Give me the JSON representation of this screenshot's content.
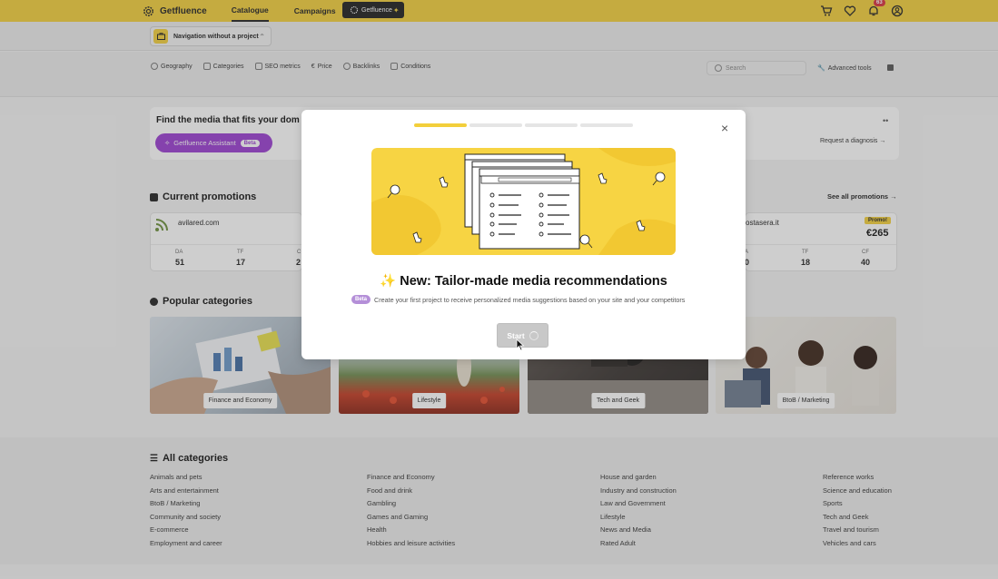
{
  "nav": {
    "brand": "Getfluence",
    "links": [
      "Catalogue",
      "Campaigns"
    ],
    "gf_button": "Getfluence",
    "notif_count": "63"
  },
  "project": {
    "label": "Navigation without a project"
  },
  "filters": {
    "items": [
      "Geography",
      "Categories",
      "SEO metrics",
      "Price",
      "Backlinks",
      "Conditions"
    ],
    "search_placeholder": "Search",
    "advanced": "Advanced tools"
  },
  "find": {
    "title": "Find the media that fits your dom",
    "assistant": "Getfluence Assistant",
    "beta": "Beta",
    "diagnosis": "Request a diagnosis →",
    "dots": "••"
  },
  "promotions": {
    "title": "Current promotions",
    "see_all": "See all promotions →",
    "cards": [
      {
        "domain": "avilared.com",
        "metrics": [
          {
            "k": "DA",
            "v": "51"
          },
          {
            "k": "TF",
            "v": "17"
          },
          {
            "k": "C",
            "v": "2"
          }
        ]
      },
      {
        "domain": "ostasera.it",
        "badge": "Promo!",
        "price": "€265",
        "metrics": [
          {
            "k": "A",
            "v": "0"
          },
          {
            "k": "TF",
            "v": "18"
          },
          {
            "k": "CF",
            "v": "40"
          }
        ]
      }
    ]
  },
  "popular": {
    "title": "Popular categories",
    "items": [
      "Finance and Economy",
      "Lifestyle",
      "Tech and Geek",
      "BtoB / Marketing"
    ]
  },
  "all_categories": {
    "title": "All categories",
    "columns": [
      [
        "Animals and pets",
        "Arts and entertainment",
        "BtoB / Marketing",
        "Community and society",
        "E-commerce",
        "Employment and career"
      ],
      [
        "Finance and Economy",
        "Food and drink",
        "Gambling",
        "Games and Gaming",
        "Health",
        "Hobbies and leisure activities"
      ],
      [
        "House and garden",
        "Industry and construction",
        "Law and Government",
        "Lifestyle",
        "News and Media",
        "Rated Adult"
      ],
      [
        "Reference works",
        "Science and education",
        "Sports",
        "Tech and Geek",
        "Travel and tourism",
        "Vehicles and cars"
      ]
    ]
  },
  "modal": {
    "title_emoji": "✨",
    "title": "New: Tailor-made media recommendations",
    "beta": "Beta",
    "description": "Create your first project to receive personalized media suggestions based on your site and your competitors",
    "start": "Start",
    "close": "×",
    "steps_total": 4,
    "steps_done": 1
  },
  "colors": {
    "brand": "#f3cf3b",
    "assistant": "#9a3dd1"
  }
}
